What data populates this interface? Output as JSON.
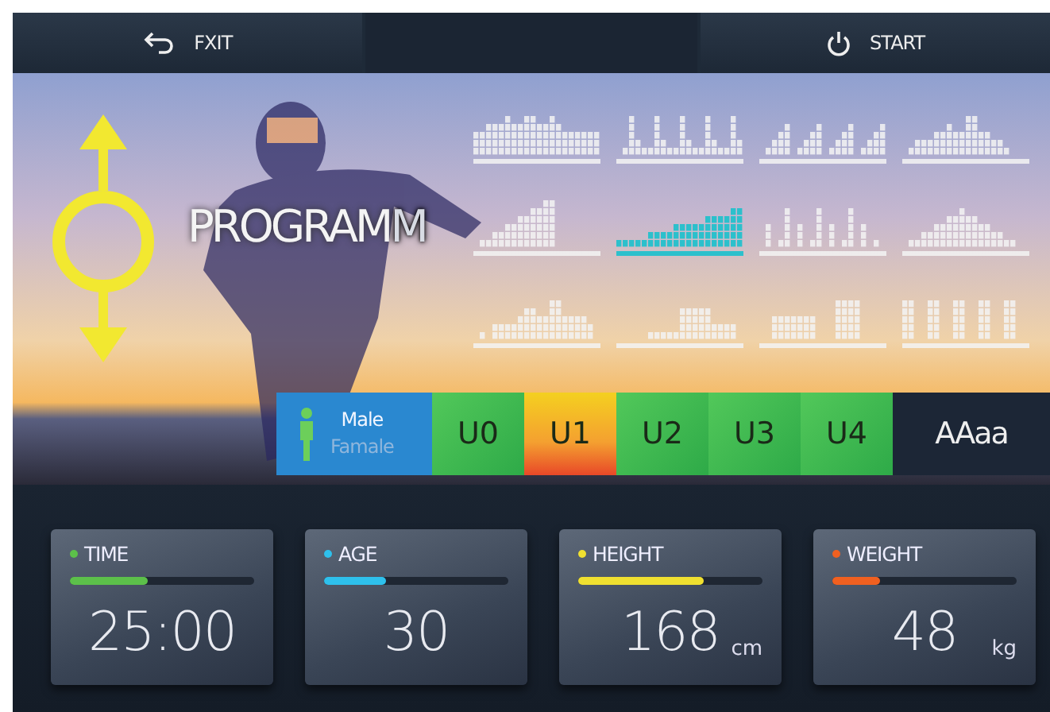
{
  "top_bar": {
    "exit": {
      "label": "FXIT"
    },
    "start": {
      "label": "START"
    }
  },
  "hero": {
    "title": "PROGRAM",
    "title_echo": "M"
  },
  "programs": [
    {
      "selected": false
    },
    {
      "selected": false
    },
    {
      "selected": false
    },
    {
      "selected": false
    },
    {
      "selected": false
    },
    {
      "selected": true
    },
    {
      "selected": false
    },
    {
      "selected": false
    },
    {
      "selected": false
    },
    {
      "selected": false
    },
    {
      "selected": false
    },
    {
      "selected": false
    }
  ],
  "gender": {
    "options": [
      {
        "label": "Male",
        "selected": true
      },
      {
        "label": "Famale",
        "selected": false
      }
    ]
  },
  "users": [
    {
      "label": "U0",
      "selected": false
    },
    {
      "label": "U1",
      "selected": true
    },
    {
      "label": "U2",
      "selected": false
    },
    {
      "label": "U3",
      "selected": false
    },
    {
      "label": "U4",
      "selected": false
    }
  ],
  "font_button": {
    "label": "AAaa"
  },
  "cards": [
    {
      "label": "TIME",
      "color": "#5cc04a",
      "level": 0.42,
      "value": "25:00"
    },
    {
      "label": "AGE",
      "color": "#2ec0ec",
      "level": 0.34,
      "value": "30"
    },
    {
      "label": "HEIGHT",
      "color": "#f0e030",
      "level": 0.68,
      "value": "168",
      "unit": "cm"
    },
    {
      "label": "WEIGHT",
      "color": "#f06020",
      "level": 0.26,
      "value": "48",
      "unit": "kg"
    }
  ]
}
